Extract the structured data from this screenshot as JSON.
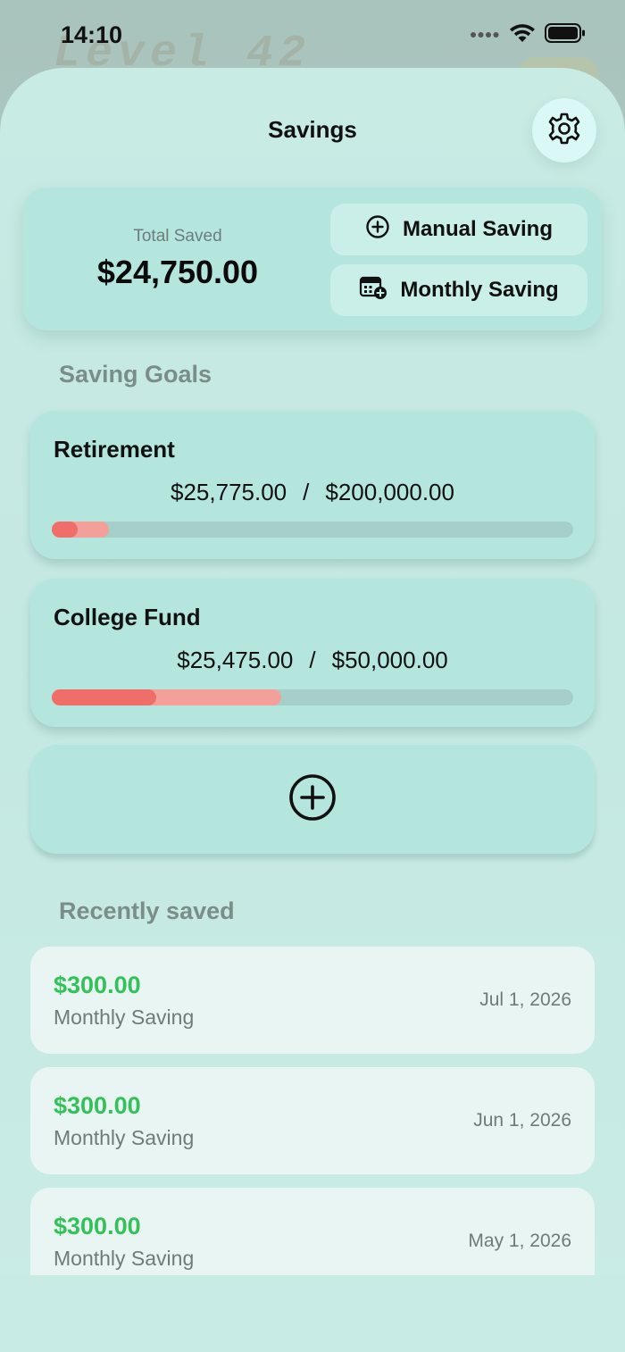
{
  "status_bar": {
    "time": "14:10"
  },
  "background": {
    "watermark_text": "Level 42"
  },
  "header": {
    "title": "Savings",
    "settings_icon": "gear-icon"
  },
  "summary": {
    "total_label": "Total Saved",
    "total_value": "$24,750.00",
    "manual_saving_label": "Manual Saving",
    "monthly_saving_label": "Monthly Saving"
  },
  "goals_section": {
    "label": "Saving Goals",
    "goals": [
      {
        "name": "Retirement",
        "saved": "$25,775.00",
        "target": "$200,000.00",
        "progress_strong": 0.05,
        "progress_light": 0.11
      },
      {
        "name": "College Fund",
        "saved": "$25,475.00",
        "target": "$50,000.00",
        "progress_strong": 0.2,
        "progress_light": 0.44
      }
    ],
    "add_goal_icon": "plus-circle-icon"
  },
  "recent_section": {
    "label": "Recently saved",
    "items": [
      {
        "amount": "$300.00",
        "type": "Monthly Saving",
        "date": "Jul 1, 2026"
      },
      {
        "amount": "$300.00",
        "type": "Monthly Saving",
        "date": "Jun 1, 2026"
      },
      {
        "amount": "$300.00",
        "type": "Monthly Saving",
        "date": "May 1, 2026"
      }
    ]
  },
  "colors": {
    "accent_green": "#35c15a",
    "progress_red": "#f06e6a",
    "progress_light": "#f4a09a",
    "card_bg": "#b4e6de"
  }
}
